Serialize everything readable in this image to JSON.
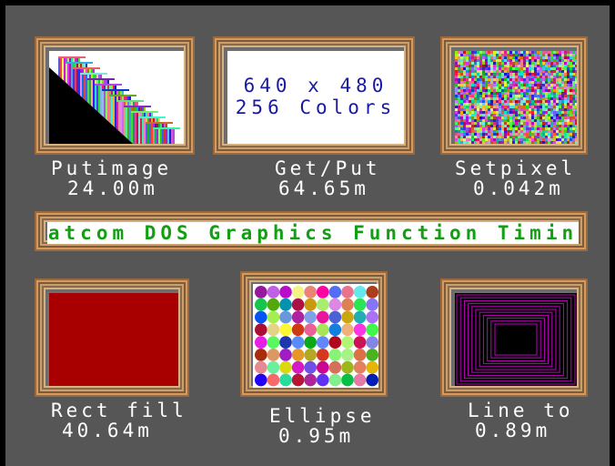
{
  "title": "Watcom DOS Graphics Function Timing",
  "resolution": {
    "line1": "640 x 480",
    "line2": "256 Colors"
  },
  "tests": [
    {
      "name": "Putimage",
      "time": "24.00m"
    },
    {
      "name": "Get/Put",
      "time": "64.65m"
    },
    {
      "name": "Setpixel",
      "time": "0.042m"
    },
    {
      "name": "Rect fill",
      "time": "40.64m"
    },
    {
      "name": "Ellipse",
      "time": "0.95m"
    },
    {
      "name": "Line to",
      "time": "0.89m"
    }
  ],
  "colors": {
    "background": "#565656",
    "banner_text": "#12a012",
    "resolution_text": "#1a1aa0",
    "rect_fill": "#a80000",
    "line_color": "#c000c0"
  }
}
